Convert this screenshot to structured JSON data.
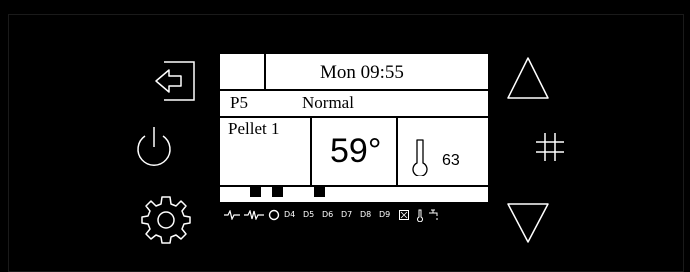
{
  "display": {
    "day_time": "Mon 09:55",
    "program_code": "P5",
    "mode": "Normal",
    "fuel": "Pellet 1",
    "temperature": "59°",
    "probe_value": "63"
  },
  "status_bar": {
    "d4": "D4",
    "d5": "D5",
    "d6": "D6",
    "d7": "D7",
    "d8": "D8",
    "d9": "D9"
  },
  "colors": {
    "background": "#000000",
    "lcd": "#ffffff",
    "icon": "#ffffff"
  },
  "icons": [
    "exit-icon",
    "power-icon",
    "settings-gear-icon",
    "up-arrow-icon",
    "hash-icon",
    "down-arrow-icon",
    "thermometer-icon"
  ]
}
